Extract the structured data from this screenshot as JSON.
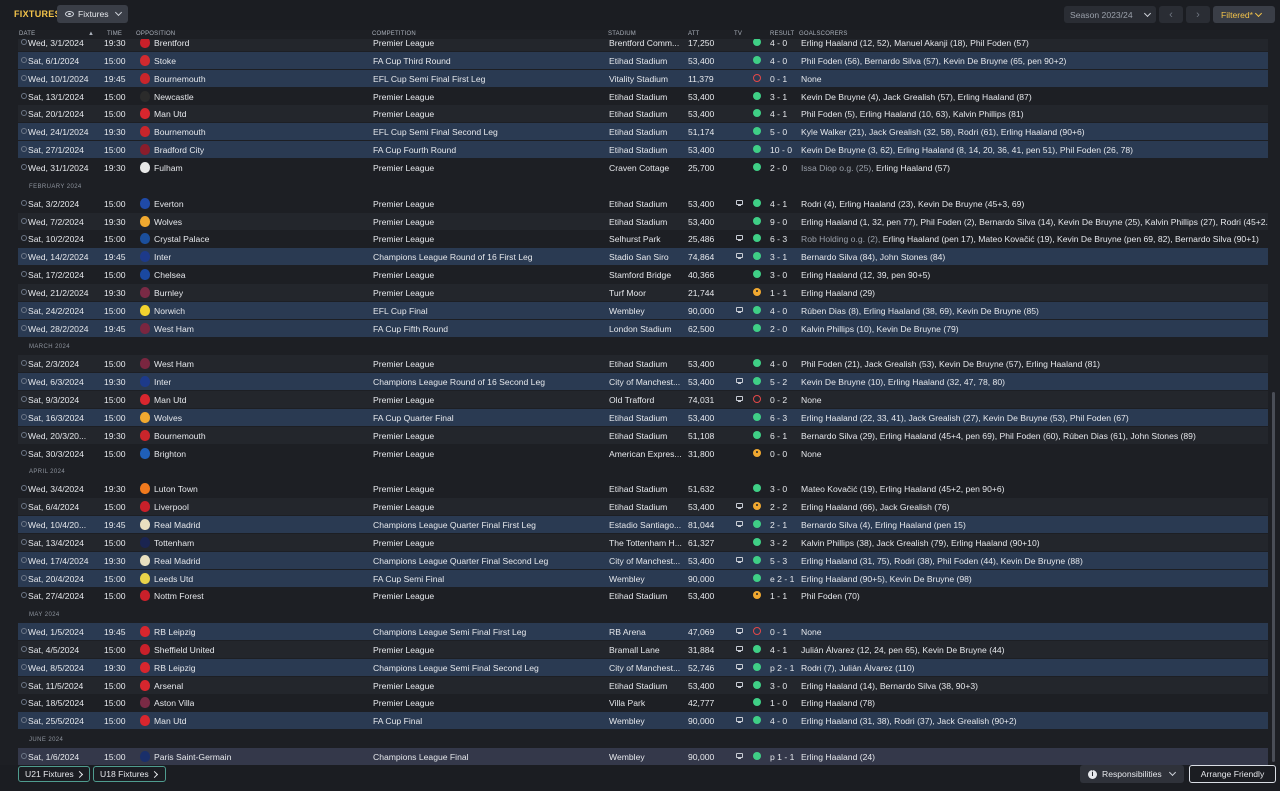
{
  "app": {
    "title": "FIXTURES",
    "view_label": "Fixtures",
    "season": "Season 2023/24",
    "filter_label": "Filtered*"
  },
  "columns": {
    "date": "DATE",
    "time": "TIME",
    "opposition": "OPPOSITION",
    "competition": "COMPETITION",
    "stadium": "STADIUM",
    "att": "ATT",
    "tv": "TV",
    "result": "RESULT",
    "goalscorers": "GOALSCORERS"
  },
  "colors": {
    "accent": "#f3c34a",
    "win": "#3fcf86",
    "loss": "#e44848",
    "draw": "#f0a830",
    "highlight_row": "#2a3a52"
  },
  "rows": [
    {
      "type": "fixture",
      "hl": false,
      "date": "Wed, 3/1/2024",
      "time": "19:30",
      "opp": "Brentford",
      "badge": "#c8202a",
      "comp": "Premier League",
      "stadium": "Brentford Comm...",
      "att": "17,250",
      "tv": false,
      "res": "W",
      "score": "4 - 0",
      "goals": "Erling Haaland (12, 52), Manuel Akanji (18), Phil Foden (57)"
    },
    {
      "type": "fixture",
      "hl": true,
      "date": "Sat, 6/1/2024",
      "time": "15:00",
      "opp": "Stoke",
      "badge": "#d12a2f",
      "comp": "FA Cup Third Round",
      "stadium": "Etihad Stadium",
      "att": "53,400",
      "tv": false,
      "res": "W",
      "score": "4 - 0",
      "goals": "Phil Foden (56), Bernardo Silva (57), Kevin De Bruyne (65, pen 90+2)"
    },
    {
      "type": "fixture",
      "hl": true,
      "date": "Wed, 10/1/2024",
      "time": "19:45",
      "opp": "Bournemouth",
      "badge": "#c9252b",
      "comp": "EFL Cup Semi Final First Leg",
      "stadium": "Vitality Stadium",
      "att": "11,379",
      "tv": false,
      "res": "L",
      "score": "0 - 1",
      "goals": "None"
    },
    {
      "type": "fixture",
      "hl": false,
      "date": "Sat, 13/1/2024",
      "time": "15:00",
      "opp": "Newcastle",
      "badge": "#2b2b2b",
      "comp": "Premier League",
      "stadium": "Etihad Stadium",
      "att": "53,400",
      "tv": false,
      "res": "W",
      "score": "3 - 1",
      "goals": "Kevin De Bruyne (4), Jack Grealish (57), Erling Haaland (87)"
    },
    {
      "type": "fixture",
      "hl": false,
      "date": "Sat, 20/1/2024",
      "time": "15:00",
      "opp": "Man Utd",
      "badge": "#d8262e",
      "comp": "Premier League",
      "stadium": "Etihad Stadium",
      "att": "53,400",
      "tv": false,
      "res": "W",
      "score": "4 - 1",
      "goals": "Phil Foden (5), Erling Haaland (10, 63), Kalvin Phillips (81)"
    },
    {
      "type": "fixture",
      "hl": true,
      "date": "Wed, 24/1/2024",
      "time": "19:30",
      "opp": "Bournemouth",
      "badge": "#c9252b",
      "comp": "EFL Cup Semi Final Second Leg",
      "stadium": "Etihad Stadium",
      "att": "51,174",
      "tv": false,
      "res": "W",
      "score": "5 - 0",
      "goals": "Kyle Walker (21), Jack Grealish (32, 58), Rodri (61), Erling Haaland (90+6)"
    },
    {
      "type": "fixture",
      "hl": true,
      "date": "Sat, 27/1/2024",
      "time": "15:00",
      "opp": "Bradford City",
      "badge": "#8a1d2c",
      "comp": "FA Cup Fourth Round",
      "stadium": "Etihad Stadium",
      "att": "53,400",
      "tv": false,
      "res": "W",
      "score": "10 - 0",
      "goals": "Kevin De Bruyne (3, 62), Erling Haaland (8, 14, 20, 36, 41, pen 51), Phil Foden (26, 78)"
    },
    {
      "type": "fixture",
      "hl": false,
      "date": "Wed, 31/1/2024",
      "time": "19:30",
      "opp": "Fulham",
      "badge": "#e8e8e8",
      "comp": "Premier League",
      "stadium": "Craven Cottage",
      "att": "25,700",
      "tv": false,
      "res": "W",
      "score": "2 - 0",
      "og": "Issa Diop o.g. (25), ",
      "goals": "Erling Haaland (57)"
    },
    {
      "type": "month",
      "label": "FEBRUARY 2024"
    },
    {
      "type": "fixture",
      "hl": false,
      "date": "Sat, 3/2/2024",
      "time": "15:00",
      "opp": "Everton",
      "badge": "#1f4aa8",
      "comp": "Premier League",
      "stadium": "Etihad Stadium",
      "att": "53,400",
      "tv": true,
      "res": "W",
      "score": "4 - 1",
      "goals": "Rodri (4), Erling Haaland (23), Kevin De Bruyne (45+3, 69)"
    },
    {
      "type": "fixture",
      "hl": false,
      "date": "Wed, 7/2/2024",
      "time": "19:30",
      "opp": "Wolves",
      "badge": "#f0a930",
      "comp": "Premier League",
      "stadium": "Etihad Stadium",
      "att": "53,400",
      "tv": false,
      "res": "W",
      "score": "9 - 0",
      "goals": "Erling Haaland (1, 32, pen 77), Phil Foden (2), Bernardo Silva (14), Kevin De Bruyne (25), Kalvin Phillips (27), Rodri (45+2..."
    },
    {
      "type": "fixture",
      "hl": false,
      "date": "Sat, 10/2/2024",
      "time": "15:00",
      "opp": "Crystal Palace",
      "badge": "#1b4f9c",
      "comp": "Premier League",
      "stadium": "Selhurst Park",
      "att": "25,486",
      "tv": true,
      "res": "W",
      "score": "6 - 3",
      "og": "Rob Holding o.g. (2), ",
      "goals": "Erling Haaland (pen 17), Mateo Kovačić (19), Kevin De Bruyne (pen 69, 82), Bernardo Silva (90+1)"
    },
    {
      "type": "fixture",
      "hl": true,
      "date": "Wed, 14/2/2024",
      "time": "19:45",
      "opp": "Inter",
      "badge": "#1d3a8a",
      "comp": "Champions League Round of 16 First Leg",
      "stadium": "Stadio San Siro",
      "att": "74,864",
      "tv": true,
      "res": "W",
      "score": "3 - 1",
      "goals": "Bernardo Silva (84), John Stones (84)"
    },
    {
      "type": "fixture",
      "hl": false,
      "date": "Sat, 17/2/2024",
      "time": "15:00",
      "opp": "Chelsea",
      "badge": "#1a48a0",
      "comp": "Premier League",
      "stadium": "Stamford Bridge",
      "att": "40,366",
      "tv": false,
      "res": "W",
      "score": "3 - 0",
      "goals": "Erling Haaland (12, 39, pen 90+5)"
    },
    {
      "type": "fixture",
      "hl": false,
      "date": "Wed, 21/2/2024",
      "time": "19:30",
      "opp": "Burnley",
      "badge": "#7a2a45",
      "comp": "Premier League",
      "stadium": "Turf Moor",
      "att": "21,744",
      "tv": false,
      "res": "D",
      "score": "1 - 1",
      "goals": "Erling Haaland (29)"
    },
    {
      "type": "fixture",
      "hl": true,
      "date": "Sat, 24/2/2024",
      "time": "15:00",
      "opp": "Norwich",
      "badge": "#f2d22e",
      "comp": "EFL Cup Final",
      "stadium": "Wembley",
      "att": "90,000",
      "tv": true,
      "res": "W",
      "score": "4 - 0",
      "goals": "Rúben Dias (8), Erling Haaland (38, 69), Kevin De Bruyne (85)"
    },
    {
      "type": "fixture",
      "hl": true,
      "date": "Wed, 28/2/2024",
      "time": "19:45",
      "opp": "West Ham",
      "badge": "#7a2640",
      "comp": "FA Cup Fifth Round",
      "stadium": "London Stadium",
      "att": "62,500",
      "tv": false,
      "res": "W",
      "score": "2 - 0",
      "goals": "Kalvin Phillips (10), Kevin De Bruyne (79)"
    },
    {
      "type": "month",
      "label": "MARCH 2024"
    },
    {
      "type": "fixture",
      "hl": false,
      "date": "Sat, 2/3/2024",
      "time": "15:00",
      "opp": "West Ham",
      "badge": "#7a2640",
      "comp": "Premier League",
      "stadium": "Etihad Stadium",
      "att": "53,400",
      "tv": false,
      "res": "W",
      "score": "4 - 0",
      "goals": "Phil Foden (21), Jack Grealish (53), Kevin De Bruyne (57), Erling Haaland (81)"
    },
    {
      "type": "fixture",
      "hl": true,
      "date": "Wed, 6/3/2024",
      "time": "19:30",
      "opp": "Inter",
      "badge": "#1d3a8a",
      "comp": "Champions League Round of 16 Second Leg",
      "stadium": "City of Manchest...",
      "att": "53,400",
      "tv": true,
      "res": "W",
      "score": "5 - 2",
      "goals": "Kevin De Bruyne (10), Erling Haaland (32, 47, 78, 80)"
    },
    {
      "type": "fixture",
      "hl": false,
      "date": "Sat, 9/3/2024",
      "time": "15:00",
      "opp": "Man Utd",
      "badge": "#d8262e",
      "comp": "Premier League",
      "stadium": "Old Trafford",
      "att": "74,031",
      "tv": true,
      "res": "L",
      "score": "0 - 2",
      "goals": "None"
    },
    {
      "type": "fixture",
      "hl": true,
      "date": "Sat, 16/3/2024",
      "time": "15:00",
      "opp": "Wolves",
      "badge": "#f0a930",
      "comp": "FA Cup Quarter Final",
      "stadium": "Etihad Stadium",
      "att": "53,400",
      "tv": false,
      "res": "W",
      "score": "6 - 3",
      "goals": "Erling Haaland (22, 33, 41), Jack Grealish (27), Kevin De Bruyne (53), Phil Foden (67)"
    },
    {
      "type": "fixture",
      "hl": false,
      "date": "Wed, 20/3/20...",
      "time": "19:30",
      "opp": "Bournemouth",
      "badge": "#c9252b",
      "comp": "Premier League",
      "stadium": "Etihad Stadium",
      "att": "51,108",
      "tv": false,
      "res": "W",
      "score": "6 - 1",
      "goals": "Bernardo Silva (29), Erling Haaland (45+4, pen 69), Phil Foden (60), Rúben Dias (61), John Stones (89)"
    },
    {
      "type": "fixture",
      "hl": false,
      "date": "Sat, 30/3/2024",
      "time": "15:00",
      "opp": "Brighton",
      "badge": "#1f5fb8",
      "comp": "Premier League",
      "stadium": "American Expres...",
      "att": "31,800",
      "tv": false,
      "res": "D",
      "score": "0 - 0",
      "goals": "None"
    },
    {
      "type": "month",
      "label": "APRIL 2024"
    },
    {
      "type": "fixture",
      "hl": false,
      "date": "Wed, 3/4/2024",
      "time": "19:30",
      "opp": "Luton Town",
      "badge": "#f07a1e",
      "comp": "Premier League",
      "stadium": "Etihad Stadium",
      "att": "51,632",
      "tv": false,
      "res": "W",
      "score": "3 - 0",
      "goals": "Mateo Kovačić (19), Erling Haaland (45+2, pen 90+6)"
    },
    {
      "type": "fixture",
      "hl": false,
      "date": "Sat, 6/4/2024",
      "time": "15:00",
      "opp": "Liverpool",
      "badge": "#c8202a",
      "comp": "Premier League",
      "stadium": "Etihad Stadium",
      "att": "53,400",
      "tv": true,
      "res": "D",
      "score": "2 - 2",
      "goals": "Erling Haaland (66), Jack Grealish (76)"
    },
    {
      "type": "fixture",
      "hl": true,
      "date": "Wed, 10/4/20...",
      "time": "19:45",
      "opp": "Real Madrid",
      "badge": "#e8e0c0",
      "comp": "Champions League Quarter Final First Leg",
      "stadium": "Estadio Santiago...",
      "att": "81,044",
      "tv": true,
      "res": "W",
      "score": "2 - 1",
      "goals": "Bernardo Silva (4), Erling Haaland (pen 15)"
    },
    {
      "type": "fixture",
      "hl": false,
      "date": "Sat, 13/4/2024",
      "time": "15:00",
      "opp": "Tottenham",
      "badge": "#1a2450",
      "comp": "Premier League",
      "stadium": "The Tottenham H...",
      "att": "61,327",
      "tv": false,
      "res": "W",
      "score": "3 - 2",
      "goals": "Kalvin Phillips (38), Jack Grealish (79), Erling Haaland (90+10)"
    },
    {
      "type": "fixture",
      "hl": true,
      "date": "Wed, 17/4/2024",
      "time": "19:30",
      "opp": "Real Madrid",
      "badge": "#e8e0c0",
      "comp": "Champions League Quarter Final Second Leg",
      "stadium": "City of Manchest...",
      "att": "53,400",
      "tv": true,
      "res": "W",
      "score": "5 - 3",
      "goals": "Erling Haaland (31, 75), Rodri (38), Phil Foden (44), Kevin De Bruyne (88)"
    },
    {
      "type": "fixture",
      "hl": true,
      "date": "Sat, 20/4/2024",
      "time": "15:00",
      "opp": "Leeds Utd",
      "badge": "#e8d34a",
      "comp": "FA Cup Semi Final",
      "stadium": "Wembley",
      "att": "90,000",
      "tv": false,
      "res": "W",
      "score": "e 2 - 1",
      "goals": "Erling Haaland (90+5), Kevin De Bruyne (98)"
    },
    {
      "type": "fixture",
      "hl": false,
      "date": "Sat, 27/4/2024",
      "time": "15:00",
      "opp": "Nottm Forest",
      "badge": "#c8202a",
      "comp": "Premier League",
      "stadium": "Etihad Stadium",
      "att": "53,400",
      "tv": false,
      "res": "D",
      "score": "1 - 1",
      "goals": "Phil Foden (70)"
    },
    {
      "type": "month",
      "label": "MAY 2024"
    },
    {
      "type": "fixture",
      "hl": true,
      "date": "Wed, 1/5/2024",
      "time": "19:45",
      "opp": "RB Leipzig",
      "badge": "#d8262e",
      "comp": "Champions League Semi Final First Leg",
      "stadium": "RB Arena",
      "att": "47,069",
      "tv": true,
      "res": "L",
      "score": "0 - 1",
      "goals": "None"
    },
    {
      "type": "fixture",
      "hl": false,
      "date": "Sat, 4/5/2024",
      "time": "15:00",
      "opp": "Sheffield United",
      "badge": "#c8202a",
      "comp": "Premier League",
      "stadium": "Bramall Lane",
      "att": "31,884",
      "tv": true,
      "res": "W",
      "score": "4 - 1",
      "goals": "Julián Álvarez (12, 24, pen 65), Kevin De Bruyne (44)"
    },
    {
      "type": "fixture",
      "hl": true,
      "date": "Wed, 8/5/2024",
      "time": "19:30",
      "opp": "RB Leipzig",
      "badge": "#d8262e",
      "comp": "Champions League Semi Final Second Leg",
      "stadium": "City of Manchest...",
      "att": "52,746",
      "tv": true,
      "res": "W",
      "score": "p 2 - 1",
      "goals": "Rodri (7), Julián Álvarez (110)"
    },
    {
      "type": "fixture",
      "hl": false,
      "date": "Sat, 11/5/2024",
      "time": "15:00",
      "opp": "Arsenal",
      "badge": "#d8262e",
      "comp": "Premier League",
      "stadium": "Etihad Stadium",
      "att": "53,400",
      "tv": true,
      "res": "W",
      "score": "3 - 0",
      "goals": "Erling Haaland (14), Bernardo Silva (38, 90+3)"
    },
    {
      "type": "fixture",
      "hl": false,
      "date": "Sat, 18/5/2024",
      "time": "15:00",
      "opp": "Aston Villa",
      "badge": "#7a2a45",
      "comp": "Premier League",
      "stadium": "Villa Park",
      "att": "42,777",
      "tv": false,
      "res": "W",
      "score": "1 - 0",
      "goals": "Erling Haaland (78)"
    },
    {
      "type": "fixture",
      "hl": true,
      "date": "Sat, 25/5/2024",
      "time": "15:00",
      "opp": "Man Utd",
      "badge": "#d8262e",
      "comp": "FA Cup Final",
      "stadium": "Wembley",
      "att": "90,000",
      "tv": true,
      "res": "W",
      "score": "4 - 0",
      "goals": "Erling Haaland (31, 38), Rodri (37), Jack Grealish (90+2)"
    },
    {
      "type": "month",
      "label": "JUNE 2024"
    },
    {
      "type": "fixture",
      "hl": "sel",
      "date": "Sat, 1/6/2024",
      "time": "15:00",
      "opp": "Paris Saint-Germain",
      "badge": "#1a2f6a",
      "comp": "Champions League Final",
      "stadium": "Wembley",
      "att": "90,000",
      "tv": true,
      "res": "W",
      "score": "p 1 - 1",
      "goals": "Erling Haaland (24)"
    }
  ],
  "footer": {
    "u21": "U21 Fixtures",
    "u18": "U18 Fixtures",
    "responsibilities": "Responsibilities",
    "arrange": "Arrange Friendly"
  }
}
